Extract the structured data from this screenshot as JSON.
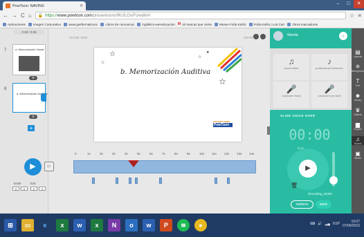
{
  "browser": {
    "tab_title": "PowToon: NAVINS",
    "url_scheme": "https://",
    "url_host": "www.powtoon.com",
    "url_path": "/presentoons/fKcfLOsIFo/edit/#/",
    "bookmarks": [
      "Aplicaciones",
      "Imagen Corporativo",
      "www.gasfermaticonc",
      "Libros de comunicac",
      "ingtiktics-wereducacion",
      "10 marcas que cierta",
      "Museo Frida Kahlo",
      "Frida Kahlo | Los Carr",
      "Otros marcadores"
    ]
  },
  "slides_panel": {
    "counter": "2:49 / 3:26",
    "slides": [
      {
        "number": "7",
        "caption": "a. Memorización Visual"
      },
      {
        "number": "8",
        "caption": "a. Memorización Auditiva"
      }
    ],
    "add_label": "+"
  },
  "canvas": {
    "left_label": "SHOW: 0000",
    "right_label": "ZOOM",
    "slide_title": "b. Memorización Auditiva",
    "logo_line1": "CREATED USING",
    "logo_line2": "PowToon"
  },
  "timeline": {
    "ticks": [
      "0",
      "1s",
      "2s",
      "3s",
      "4s",
      "5s",
      "6s",
      "7s",
      "8s",
      "9s",
      "10s",
      "11s",
      "12s",
      "13s",
      "14s"
    ],
    "enter_label": "Enter",
    "exit_label": "Exit",
    "enter_value": "0",
    "exit_value": "0"
  },
  "right_panel": {
    "user_name": "Wanda",
    "options": [
      {
        "icon": "♫",
        "label": "sound track"
      },
      {
        "icon": "♪",
        "label": "professional voiceover"
      },
      {
        "icon": "🎤",
        "label": "voiceover track"
      },
      {
        "icon": "🎤",
        "label": "voiceover per slide"
      }
    ],
    "vo_title": "SLIDE VOICE OVER",
    "vo_time": "00:00",
    "vo_sub": "0:14",
    "record_label": "Recording_slide8",
    "replace_label": "replace",
    "save_label": "save"
  },
  "right_toolbar": [
    "Layouts",
    "Backgrounds",
    "Text",
    "Library",
    "Objects",
    "Graphs",
    "Sound",
    "Media"
  ],
  "taskbar": {
    "apps": [
      "start",
      "explorer",
      "ie",
      "excel",
      "word",
      "excel2",
      "onenote",
      "outlook",
      "word2",
      "powerpoint",
      "spotify",
      "chrome"
    ],
    "lang": "ESP",
    "time": "19:07",
    "date": "07/06/2016"
  }
}
